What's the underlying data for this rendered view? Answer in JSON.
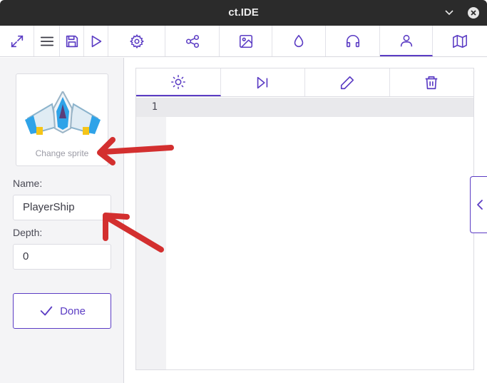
{
  "window": {
    "title": "ct.IDE",
    "accent_color": "#5b3cc4"
  },
  "toolbar": {
    "buttons": [
      {
        "icon": "fullscreen-icon"
      },
      {
        "icon": "menu-icon"
      },
      {
        "icon": "save-icon"
      },
      {
        "icon": "play-icon"
      },
      {
        "icon": "settings-icon"
      },
      {
        "icon": "modules-icon"
      },
      {
        "icon": "textures-icon"
      },
      {
        "icon": "styles-icon"
      },
      {
        "icon": "sounds-icon"
      },
      {
        "icon": "types-icon",
        "active": true
      },
      {
        "icon": "rooms-icon"
      }
    ]
  },
  "left_panel": {
    "sprite_caption": "Change sprite",
    "name_label": "Name:",
    "name_value": "PlayerShip",
    "depth_label": "Depth:",
    "depth_value": "0",
    "done_label": "Done"
  },
  "editor": {
    "tabs": [
      {
        "icon": "on-create-icon",
        "active": true
      },
      {
        "icon": "on-step-icon"
      },
      {
        "icon": "on-draw-icon"
      },
      {
        "icon": "on-destroy-icon"
      }
    ],
    "line_numbers": [
      "1"
    ]
  }
}
